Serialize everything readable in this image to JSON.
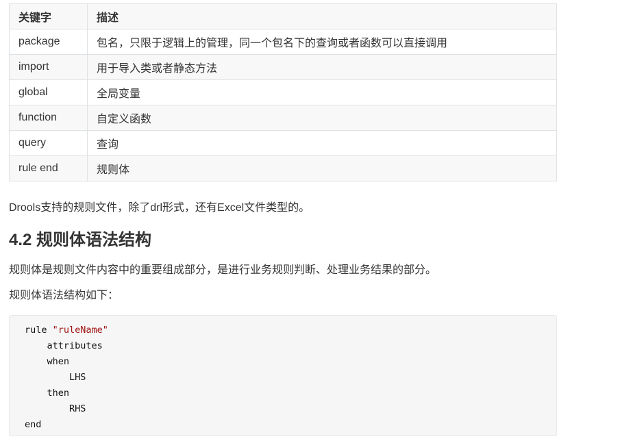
{
  "table": {
    "headers": [
      "关键字",
      "描述"
    ],
    "rows": [
      [
        "package",
        "包名，只限于逻辑上的管理，同一个包名下的查询或者函数可以直接调用"
      ],
      [
        "import",
        "用于导入类或者静态方法"
      ],
      [
        "global",
        "全局变量"
      ],
      [
        "function",
        "自定义函数"
      ],
      [
        "query",
        "查询"
      ],
      [
        "rule end",
        "规则体"
      ]
    ]
  },
  "paragraph1": "Drools支持的规则文件，除了drl形式，还有Excel文件类型的。",
  "heading": "4.2 规则体语法结构",
  "paragraph2": "规则体是规则文件内容中的重要组成部分，是进行业务规则判断、处理业务结果的部分。",
  "paragraph3": "规则体语法结构如下：",
  "code": {
    "line1_kw": "rule ",
    "line1_str": "\"ruleName\"",
    "line2": "    attributes",
    "line3": "    when",
    "line4": "        LHS",
    "line5": "    then",
    "line6": "        RHS",
    "line7": "end"
  }
}
